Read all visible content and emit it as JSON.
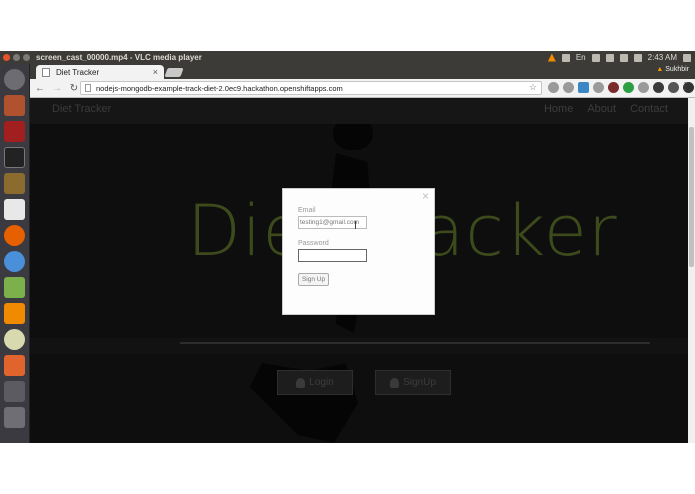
{
  "os_topbar": {
    "window_title": "screen_cast_00000.mp4 - VLC media player",
    "time": "2:43 AM",
    "user": "Sukhbir",
    "keyboard": "En"
  },
  "launcher": {
    "items": [
      "ubuntu-dash-icon",
      "files-icon",
      "video-icon",
      "terminal-icon",
      "archive-icon",
      "settings-icon",
      "firefox-icon",
      "chromium-icon",
      "android-studio-icon",
      "vlc-icon",
      "camera-icon",
      "software-center-icon",
      "workspace-icon",
      "trash-icon"
    ]
  },
  "browser": {
    "tab_title": "Diet Tracker",
    "url": "nodejs-mongodb-example-track-diet-2.0ec9.hackathon.openshiftapps.com",
    "profile": "Sukhbir"
  },
  "site": {
    "brand": "Diet Tracker",
    "nav": [
      "Home",
      "About",
      "Contact"
    ],
    "hero_title": "Diet Tracker",
    "login_label": "Login",
    "signup_label": "SignUp"
  },
  "modal": {
    "close_glyph": "×",
    "email_label": "Email",
    "email_value": "testing1@gmail.com",
    "password_label": "Password",
    "password_value": "",
    "submit_label": "Sign Up"
  },
  "colors": {
    "hero_title": "#3c4a1c",
    "page_bg": "#0e0e0e",
    "ubuntu_bar": "#3c3b37"
  }
}
